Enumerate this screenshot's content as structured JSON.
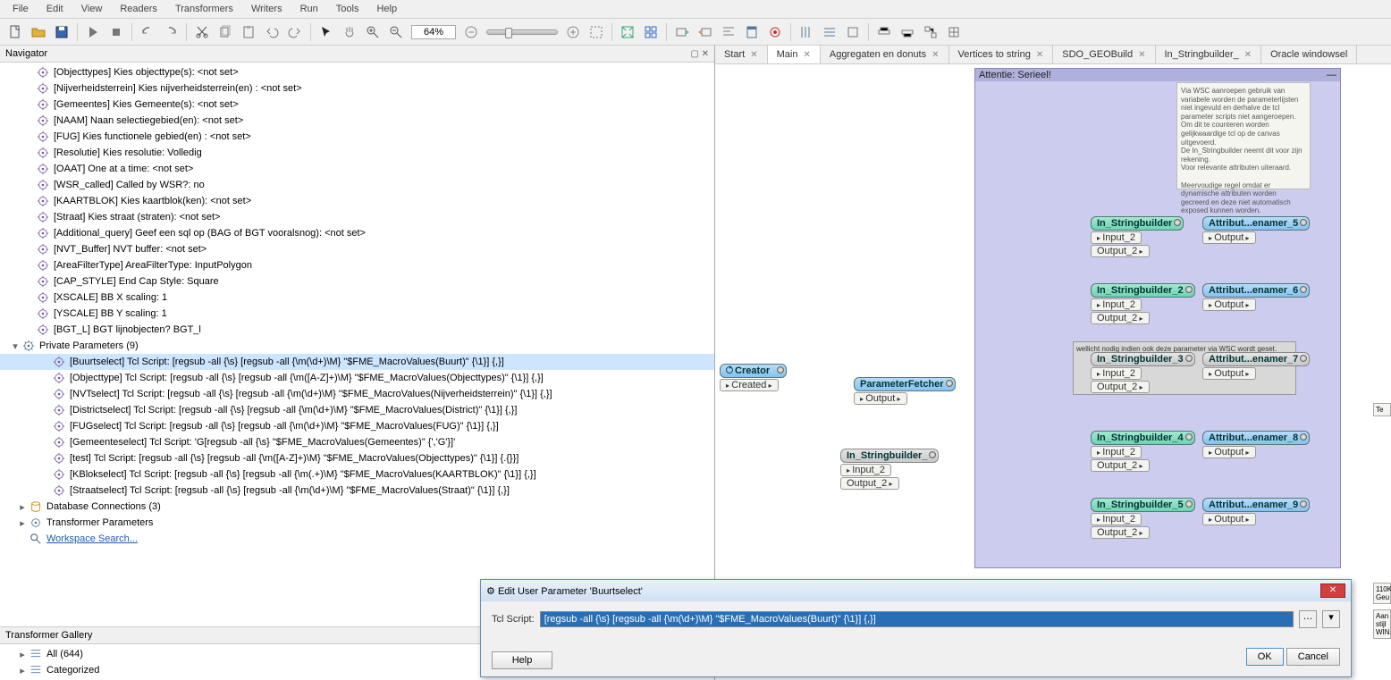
{
  "menu": [
    "File",
    "Edit",
    "View",
    "Readers",
    "Transformers",
    "Writers",
    "Run",
    "Tools",
    "Help"
  ],
  "zoom": "64%",
  "navigator_title": "Navigator",
  "tree": {
    "params": [
      "[Objecttypes] Kies objecttype(s): <not set>",
      "[Nijverheidsterrein] Kies nijverheidsterrein(en) : <not set>",
      "[Gemeentes] Kies Gemeente(s): <not set>",
      "[NAAM] Naan selectiegebied(en): <not set>",
      "[FUG] Kies functionele gebied(en) : <not set>",
      "[Resolutie] Kies resolutie: Volledig",
      "[OAAT] One at a time: <not set>",
      "[WSR_called] Called by WSR?: no",
      "[KAARTBLOK] Kies kaartblok(ken): <not set>",
      "[Straat] Kies straat (straten): <not set>",
      "[Additional_query] Geef een sql op (BAG of BGT vooralsnog): <not set>",
      "[NVT_Buffer] NVT buffer: <not set>",
      "[AreaFilterType] AreaFilterType: InputPolygon",
      "[CAP_STYLE] End Cap Style: Square",
      "[XSCALE] BB X scaling: 1",
      "[YSCALE] BB Y scaling: 1",
      "[BGT_L] BGT lijnobjecten? BGT_l"
    ],
    "private_label": "Private Parameters (9)",
    "private": [
      "[Buurtselect] Tcl Script: [regsub -all {\\s} [regsub -all {\\m(\\d+)\\M} \"$FME_MacroValues(Buurt)\" {\\1}] {,}]",
      "[Objecttype] Tcl Script: [regsub -all {\\s} [regsub -all {\\m([A-Z]+)\\M} \"$FME_MacroValues(Objecttypes)\" {\\1}] {,}]",
      "[NVTselect] Tcl Script: [regsub -all {\\s} [regsub -all {\\m(\\d+)\\M} \"$FME_MacroValues(Nijverheidsterrein)\" {\\1}] {,}]",
      "[Districtselect] Tcl Script: [regsub -all {\\s} [regsub -all {\\m(\\d+)\\M} \"$FME_MacroValues(District)\" {\\1}] {,}]",
      "[FUGselect] Tcl Script: [regsub -all {\\s} [regsub -all {\\m(\\d+)\\M} \"$FME_MacroValues(FUG)\" {\\1}] {,}]",
      "[Gemeenteselect] Tcl Script: 'G[regsub -all {\\s}  \"$FME_MacroValues(Gemeentes)\" {','G'}]'",
      "[test] Tcl Script: [regsub -all {\\s} [regsub  -all {\\m([A-Z]+)\\M} \"$FME_MacroValues(Objecttypes)\" {\\1}] {.{}}]",
      "[KBlokselect] Tcl Script: [regsub -all {\\s} [regsub -all {\\m(.+)\\M} \"$FME_MacroValues(KAARTBLOK)\" {\\1}] {,}]",
      "[Straatselect] Tcl Script: [regsub -all {\\s} [regsub -all {\\m(\\d+)\\M} \"$FME_MacroValues(Straat)\" {\\1}] {,}]"
    ],
    "dbcon": "Database Connections (3)",
    "tfmparams": "Transformer Parameters",
    "search": "Workspace Search..."
  },
  "gallery": {
    "title": "Transformer Gallery",
    "all": "All (644)",
    "cat": "Categorized"
  },
  "tabs": [
    {
      "label": "Start",
      "active": false
    },
    {
      "label": "Main",
      "active": true
    },
    {
      "label": "Aggregaten en donuts",
      "active": false
    },
    {
      "label": "Vertices to string",
      "active": false
    },
    {
      "label": "SDO_GEOBuild",
      "active": false
    },
    {
      "label": "In_Stringbuilder_",
      "active": false
    },
    {
      "label": "Oracle windowsel",
      "active": false
    }
  ],
  "canvas": {
    "bookmark_title": "Attentie: Serieel!",
    "note": "Via WSC aanroepen gebruik van variabele worden de parameterlijsten niet ingevuld en derhalve de tcl parameter scripts niet aangeroepen.\nOm dit te counteren worden gelijkwaardige tcl op de canvas uitgevoerd.\nDe In_Stringbuilder neemt dit voor zijn rekening.\nVoor relevante attributen uiteraard.\n\nMeervoudige regel omdat er dynamische attributen worden gecreerd en deze niet automatisch exposed kunnen worden.",
    "note2": "wellicht nodig indien ook deze parameter via WSC wordt geset.",
    "creator": {
      "name": "Creator",
      "port": "Created"
    },
    "paramfetcher": {
      "name": "ParameterFetcher",
      "port": "Output"
    },
    "instr_side": {
      "name": "In_Stringbuilder_",
      "p1": "Input_2",
      "p2": "Output_2"
    },
    "instr": [
      {
        "name": "In_Stringbuilder",
        "p1": "Input_2",
        "p2": "Output_2"
      },
      {
        "name": "In_Stringbuilder_2",
        "p1": "Input_2",
        "p2": "Output_2"
      },
      {
        "name": "In_Stringbuilder_3",
        "p1": "Input_2",
        "p2": "Output_2"
      },
      {
        "name": "In_Stringbuilder_4",
        "p1": "Input_2",
        "p2": "Output_2"
      },
      {
        "name": "In_Stringbuilder_5",
        "p1": "Input_2",
        "p2": "Output_2"
      }
    ],
    "attr": [
      {
        "name": "Attribut...enamer_5",
        "port": "Output"
      },
      {
        "name": "Attribut...enamer_6",
        "port": "Output"
      },
      {
        "name": "Attribut...enamer_7",
        "port": "Output"
      },
      {
        "name": "Attribut...enamer_8",
        "port": "Output"
      },
      {
        "name": "Attribut...enamer_9",
        "port": "Output"
      }
    ]
  },
  "dialog": {
    "title": "Edit User Parameter 'Buurtselect'",
    "label": "Tcl Script:",
    "value": "[regsub -all {\\s} [regsub -all {\\m(\\d+)\\M} \"$FME_MacroValues(Buurt)\" {\\1}] {,}]",
    "help": "Help",
    "ok": "OK",
    "cancel": "Cancel"
  },
  "sidebar_stubs": [
    "Te",
    "110K Geu",
    "Aan stijl WIN"
  ]
}
